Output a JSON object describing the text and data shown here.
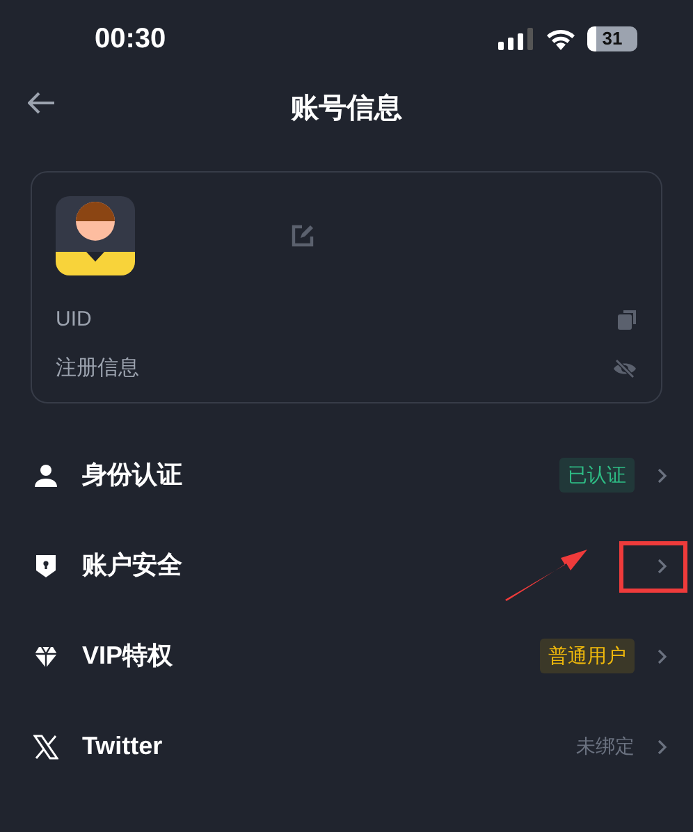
{
  "status_bar": {
    "time": "00:30",
    "battery": "31"
  },
  "header": {
    "title": "账号信息"
  },
  "profile_card": {
    "uid_label": "UID",
    "registration_label": "注册信息"
  },
  "menu": [
    {
      "kind": "identity",
      "label": "身份认证",
      "status": {
        "kind": "badge",
        "text": "已认证",
        "color": "#2ebd85"
      },
      "highlighted": false
    },
    {
      "kind": "security",
      "label": "账户安全",
      "highlighted": true
    },
    {
      "kind": "vip",
      "label": "VIP特权",
      "status": {
        "kind": "badge",
        "text": "普通用户",
        "color": "#f0b90b"
      },
      "highlighted": false
    },
    {
      "kind": "twitter",
      "label": "Twitter",
      "status": {
        "kind": "text",
        "text": "未绑定"
      },
      "highlighted": false
    }
  ]
}
